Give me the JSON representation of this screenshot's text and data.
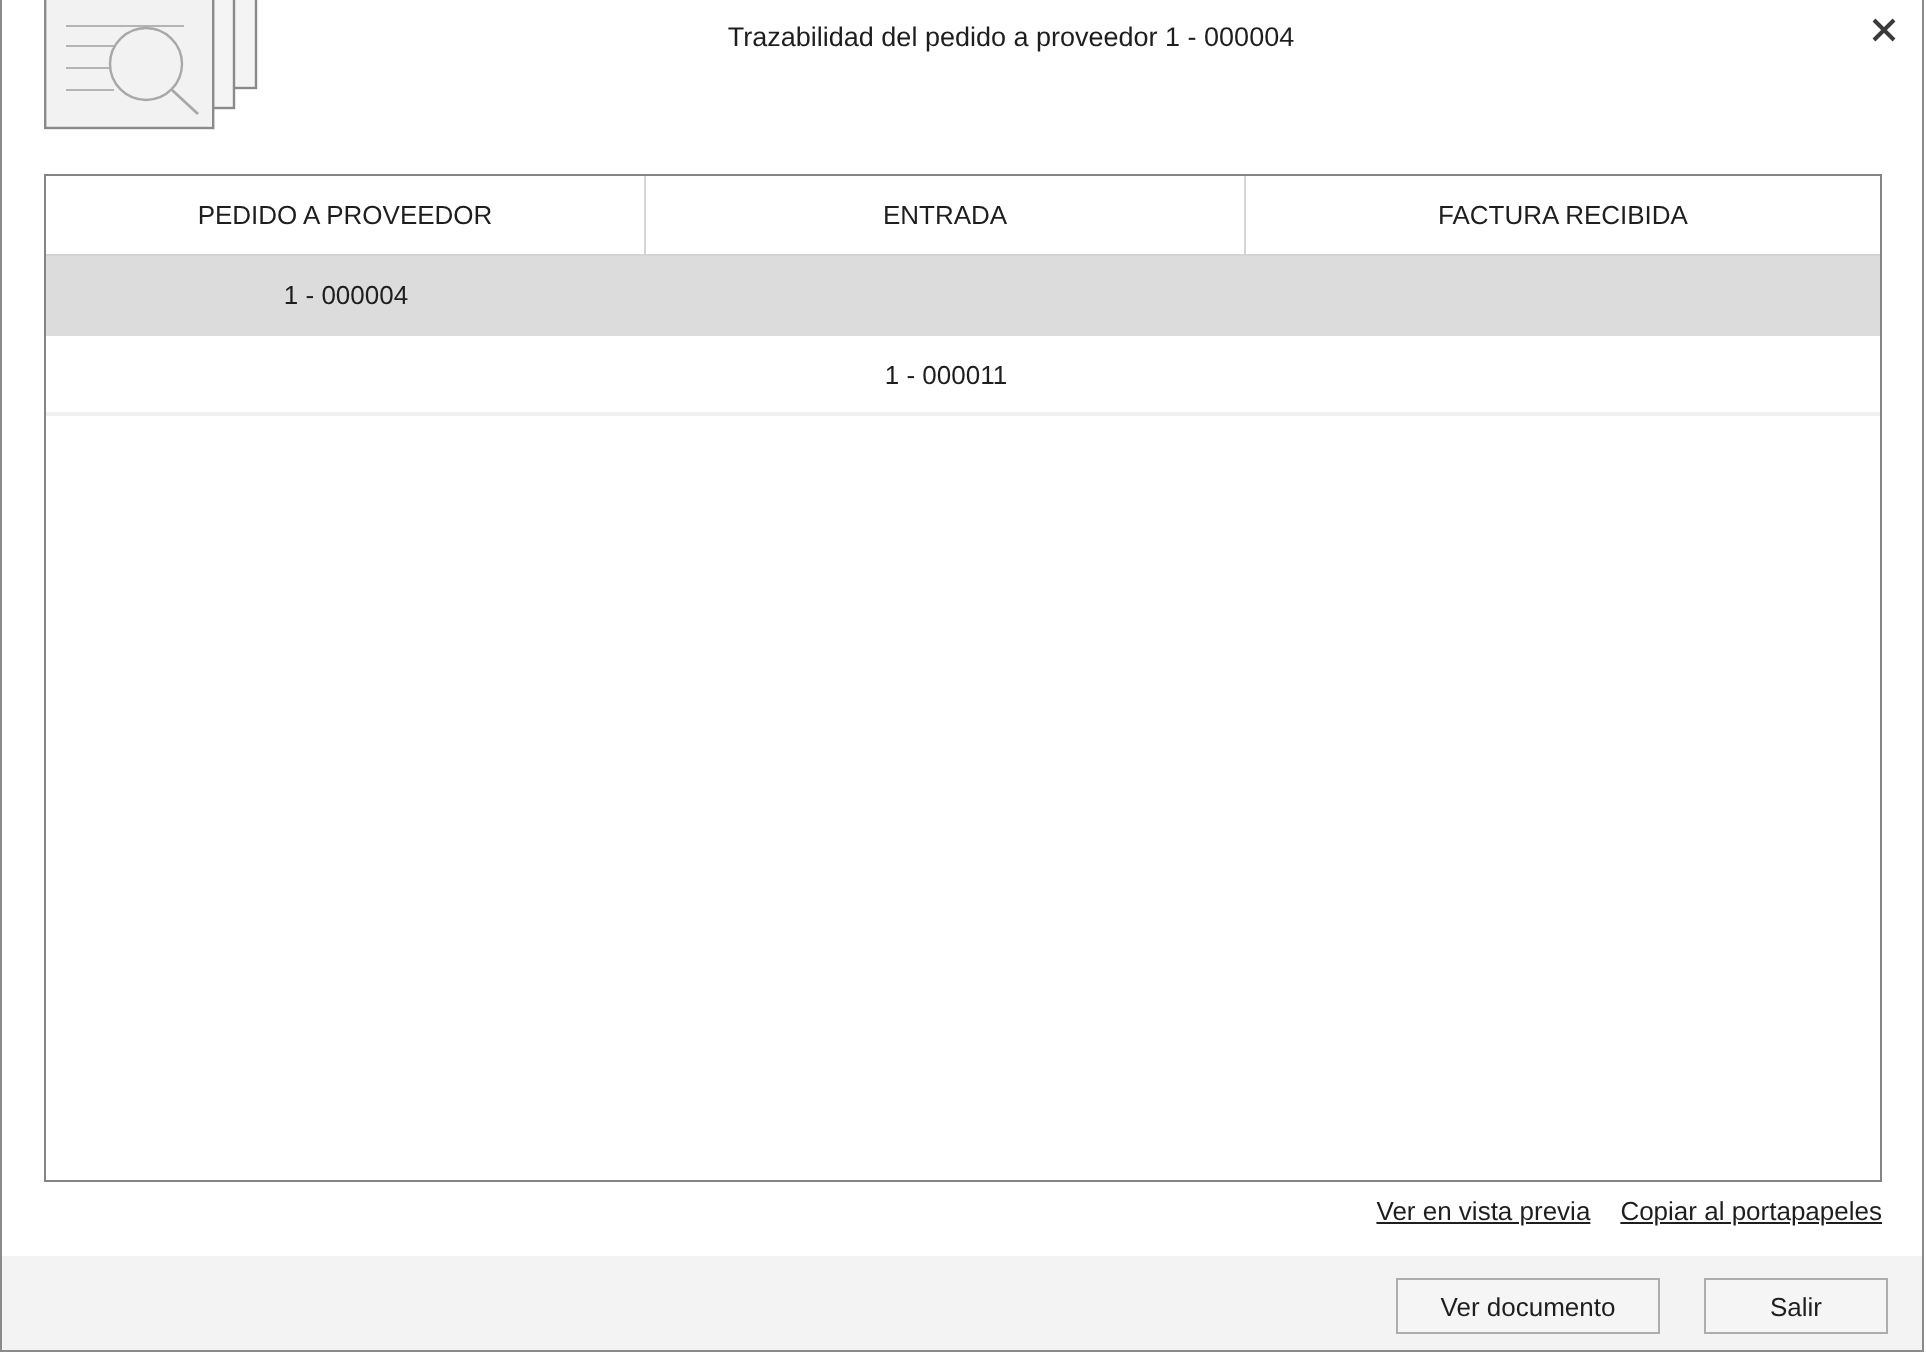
{
  "window": {
    "title": "Trazabilidad del pedido a proveedor 1 - 000004"
  },
  "table": {
    "columns": [
      "PEDIDO A PROVEEDOR",
      "ENTRADA",
      "FACTURA RECIBIDA"
    ],
    "rows": [
      {
        "selected": true,
        "cells": [
          "1 - 000004",
          null,
          null
        ]
      },
      {
        "selected": false,
        "cells": [
          null,
          "1 - 000011",
          null
        ]
      }
    ]
  },
  "links": [
    "Ver en vista previa",
    "Copiar al portapapeles"
  ],
  "buttons": [
    "Ver documento",
    "Salir"
  ]
}
